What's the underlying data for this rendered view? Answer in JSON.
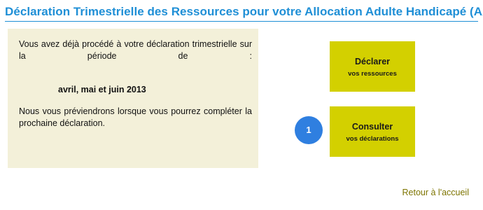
{
  "header": {
    "title": "Déclaration Trimestrielle des Ressources pour votre Allocation Adulte Handicapé (AAH)"
  },
  "info_panel": {
    "intro": "Vous avez déjà procédé à votre déclaration trimestrielle sur la période de :",
    "period": "avril, mai et juin 2013",
    "notice": "Nous vous préviendrons lorsque vous pourrez compléter la prochaine déclaration."
  },
  "actions": {
    "declarer": {
      "title": "Déclarer",
      "subtitle": "vos ressources"
    },
    "consulter": {
      "title": "Consulter",
      "subtitle": "vos déclarations",
      "badge": "1"
    }
  },
  "footer": {
    "back_link": "Retour à l'accueil"
  },
  "colors": {
    "title_blue": "#1f8fd6",
    "panel_bg": "#f3f0d9",
    "tile_bg": "#d3d000",
    "badge_bg": "#2f7fe0",
    "link_olive": "#7d7400"
  }
}
